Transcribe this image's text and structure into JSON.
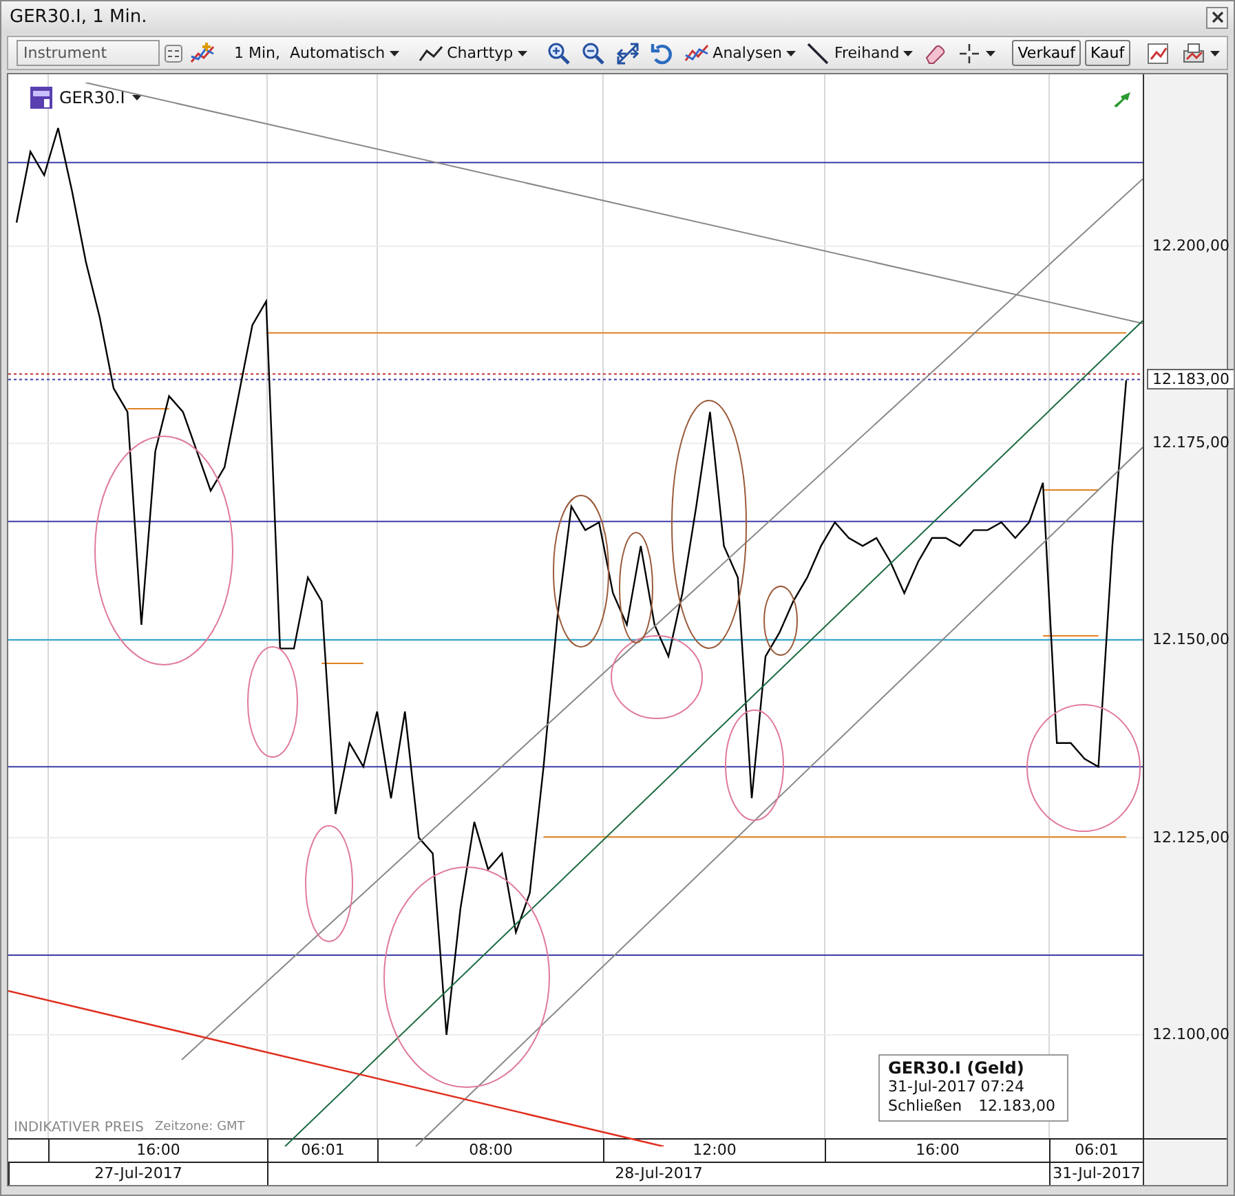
{
  "window": {
    "title": "GER30.I, 1 Min."
  },
  "toolbar": [
    {
      "kind": "field",
      "placeholder": "Instrument"
    },
    {
      "kind": "tool"
    },
    {
      "kind": "separator"
    },
    {
      "kind": "dropdown",
      "label": "1 Min,  Automatisch",
      "has_icon": false
    },
    {
      "kind": "separator"
    },
    {
      "kind": "dropdown",
      "label": "Charttyp",
      "has_icon": true
    },
    {
      "kind": "separator"
    },
    {
      "kind": "tool"
    },
    {
      "kind": "tool"
    },
    {
      "kind": "tool"
    },
    {
      "kind": "tool"
    },
    {
      "kind": "dropdown",
      "label": "Analysen",
      "has_icon": true
    },
    {
      "kind": "dropdown",
      "label": "Freihand",
      "has_icon": true
    },
    {
      "kind": "tool"
    },
    {
      "kind": "tool_dropdown"
    },
    {
      "kind": "separator"
    },
    {
      "kind": "button",
      "label": "Verkauf"
    },
    {
      "kind": "button",
      "label": "Kauf"
    },
    {
      "kind": "separator"
    },
    {
      "kind": "tool"
    },
    {
      "kind": "tool_dropdown"
    }
  ],
  "chart": {
    "instrument": "GER30.I",
    "price_label": "12.183,00",
    "footer_note": "INDIKATIVER PREIS",
    "timezone": "Zeitzone: GMT",
    "dates": [
      "27-Jul-2017",
      "28-Jul-2017",
      "31-Jul-2017"
    ],
    "time_labels": [
      "16:00",
      "06:01",
      "08:00",
      "12:00",
      "16:00",
      "06:01"
    ],
    "chart_data": {
      "type": "line",
      "ylim": [
        12086.9,
        12221.8
      ],
      "grid": true,
      "ref_lines": [
        {
          "axis": "y",
          "value": 12210.6,
          "color": "#3c3ca8"
        },
        {
          "axis": "y",
          "value": 12165.1,
          "color": "#3c3ca8"
        },
        {
          "axis": "y",
          "value": 12134,
          "color": "#3c3ca8"
        },
        {
          "axis": "y",
          "value": 12110.1,
          "color": "#3c3ca8"
        },
        {
          "axis": "y",
          "value": 12150.1,
          "color": "#22a0c8"
        },
        {
          "axis": "y",
          "value": 12183.8,
          "color": "#c03030"
        },
        {
          "axis": "y",
          "value": 12183.1,
          "color": "#3c3ca8"
        }
      ],
      "yticks": [
        {
          "value": 12100,
          "label": "12.100,00"
        },
        {
          "value": 12125,
          "label": "12.125,00"
        },
        {
          "value": 12150,
          "label": "12.150,00"
        },
        {
          "value": 12175,
          "label": "12.175,00"
        },
        {
          "value": 12200,
          "label": "12.200,00"
        }
      ],
      "series": [
        {
          "color": "#000000",
          "values": [
            12203,
            12212,
            12209,
            12215,
            12207,
            12198,
            12191,
            12182,
            12179,
            12152,
            12174,
            12181,
            12179,
            12174,
            12169,
            12172,
            12181,
            12190,
            12193,
            12149,
            12149,
            12158,
            12155,
            12128,
            12137,
            12134,
            12141,
            12130,
            12141,
            12125,
            12123,
            12100,
            12116,
            12127,
            12121,
            12123,
            12113,
            12118,
            12134,
            12153,
            12167,
            12164,
            12165,
            12156,
            12152,
            12162,
            12152,
            12148,
            12156,
            12167,
            12179,
            12162,
            12158,
            12130,
            12148,
            12151,
            12155,
            12158,
            12162,
            12165,
            12163,
            12162,
            12163,
            12160,
            12156,
            12160,
            12163,
            12163,
            12162,
            12164,
            12164,
            12165,
            12163,
            12165,
            12170,
            12137,
            12137,
            12135,
            12134,
            12162,
            12183
          ]
        },
        {
          "color": "#e08020",
          "values": [
            null,
            null,
            null,
            null,
            null,
            null,
            null,
            null,
            null,
            null,
            null,
            null,
            null,
            null,
            null,
            null,
            null,
            null,
            12189,
            12189,
            12189,
            12189,
            12189,
            12189,
            12189,
            12189,
            12189,
            12189,
            12189,
            12189,
            12189,
            12189,
            12189,
            12189,
            12189,
            12189,
            12189,
            12189,
            12189,
            12189,
            12189,
            12189,
            12189,
            12189,
            12189,
            12189,
            12189,
            12189,
            12189,
            12189,
            12189,
            12189,
            12189,
            12189,
            12189,
            12189,
            12189,
            12189,
            12189,
            12189,
            12189,
            12189,
            12189,
            12189,
            12189,
            12189,
            12189,
            12189,
            12189,
            12189,
            12189,
            12189,
            12189,
            12189,
            12189,
            12189,
            12189,
            12189,
            12189,
            12189,
            12189
          ]
        },
        {
          "color": "#e08020",
          "values": [
            null,
            null,
            null,
            null,
            null,
            null,
            null,
            null,
            12179.4,
            12179.4,
            12179.4,
            12179.4,
            null,
            null,
            null,
            null,
            null,
            null,
            null,
            null,
            null,
            null,
            12147.1,
            12147.1,
            12147.1,
            12147.1,
            null,
            null,
            null,
            null,
            null,
            null,
            null,
            null,
            null,
            null,
            null,
            null,
            12125.1,
            12125.1,
            12125.1,
            12125.1,
            12125.1,
            12125.1,
            12125.1,
            12125.1,
            12125.1,
            12125.1,
            12125.1,
            12125.1,
            12125.1,
            12125.1,
            12125.1,
            12125.1,
            12125.1,
            12125.1,
            12125.1,
            12125.1,
            12125.1,
            12125.1,
            12125.1,
            12125.1,
            12125.1,
            12125.1,
            12125.1,
            12125.1,
            12125.1,
            12125.1,
            12125.1,
            12125.1,
            12125.1,
            12125.1,
            12125.1,
            12125.1,
            12125.1,
            12125.1,
            12125.1,
            12125.1,
            12125.1,
            12125.1,
            12125.1
          ]
        },
        {
          "color": "#e08020",
          "values": [
            null,
            null,
            null,
            null,
            null,
            null,
            null,
            null,
            null,
            null,
            null,
            null,
            null,
            null,
            null,
            null,
            null,
            null,
            null,
            null,
            null,
            null,
            null,
            null,
            null,
            null,
            null,
            null,
            null,
            null,
            null,
            null,
            null,
            null,
            null,
            null,
            null,
            null,
            null,
            null,
            null,
            null,
            null,
            null,
            null,
            null,
            null,
            null,
            null,
            null,
            null,
            null,
            null,
            null,
            null,
            null,
            null,
            null,
            null,
            null,
            null,
            null,
            null,
            null,
            null,
            null,
            null,
            null,
            null,
            null,
            null,
            null,
            null,
            null,
            12150.6,
            12150.6,
            12150.6,
            12150.6,
            12150.6,
            null,
            null
          ]
        },
        {
          "color": "#e08020",
          "values": [
            null,
            null,
            null,
            null,
            null,
            null,
            null,
            null,
            null,
            null,
            null,
            null,
            null,
            null,
            null,
            null,
            null,
            null,
            null,
            null,
            null,
            null,
            null,
            null,
            null,
            null,
            null,
            null,
            null,
            null,
            null,
            null,
            null,
            null,
            null,
            null,
            null,
            null,
            null,
            null,
            null,
            null,
            null,
            null,
            null,
            null,
            null,
            null,
            null,
            null,
            null,
            null,
            null,
            null,
            null,
            null,
            null,
            null,
            null,
            null,
            null,
            null,
            null,
            null,
            null,
            null,
            null,
            null,
            null,
            null,
            null,
            null,
            null,
            null,
            12169.1,
            12169.1,
            12169.1,
            12169.1,
            12169.1,
            null,
            null
          ]
        }
      ]
    }
  },
  "info_box": {
    "title": "GER30.I (Geld)",
    "datetime": "31-Jul-2017 07:24",
    "label": "Schließen",
    "value": "12.183,00"
  }
}
